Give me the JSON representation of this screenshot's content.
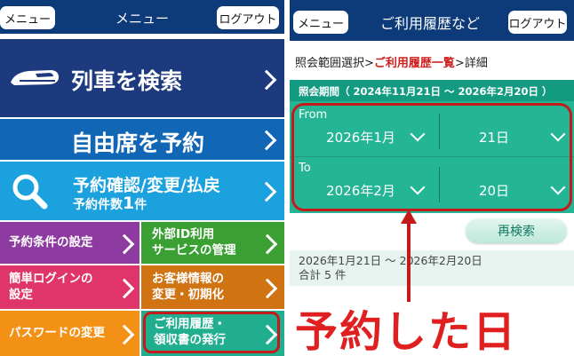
{
  "left": {
    "header": {
      "menu_button": "メニュー",
      "title": "メニュー",
      "logout_button": "ログアウト"
    },
    "tiles": {
      "search_train": "列車を検索",
      "reserve_free_seat": "自由席を予約",
      "confirm_line1": "予約確認/変更/払戻",
      "confirm_count_prefix": "予約件数",
      "confirm_count": "1",
      "confirm_count_suffix": "件",
      "reservation_conditions": "予約条件の設定",
      "external_id_line1": "外部ID利用",
      "external_id_line2": "サービスの管理",
      "easy_login_line1": "簡単ログインの",
      "easy_login_line2": "設定",
      "customer_info_line1": "お客様情報の",
      "customer_info_line2": "変更・初期化",
      "password_change": "パスワードの変更",
      "history_line1": "ご利用履歴・",
      "history_line2": "領収書の発行"
    }
  },
  "right": {
    "header": {
      "menu_button": "メニュー",
      "title": "ご利用履歴など",
      "logout_button": "ログアウト"
    },
    "breadcrumb": {
      "step1": "照会範囲選択>",
      "step2": "ご利用履歴一覧",
      "step3": ">詳細"
    },
    "period": "照会期間（ 2024年11月21日 ～ 2026年2月20日 ）",
    "from": {
      "label": "From",
      "month": "2026年1月",
      "day": "21日"
    },
    "to": {
      "label": "To",
      "month": "2026年2月",
      "day": "20日"
    },
    "research_button": "再検索",
    "result_range": "2026年1月21日 ～ 2026年2月20日",
    "result_total": "合計 5 件"
  },
  "annotation": {
    "text": "予約した日"
  },
  "colors": {
    "header_navy": "#0d3a78",
    "tile_search": "#1d3a7e",
    "tile_free_seat": "#1167b5",
    "tile_confirm": "#1aa1de",
    "tile_conditions": "#8e3ba1",
    "tile_external_id": "#3aa033",
    "tile_easy_login": "#e0356a",
    "tile_customer_info": "#cf7313",
    "tile_password": "#f39117",
    "tile_history": "#21ae8e",
    "highlight_red": "#c41a1a",
    "selector_teal": "#24b595"
  },
  "icons": [
    "shinkansen-icon",
    "magnifier-icon",
    "chevron-right-icon",
    "chevron-down-icon",
    "up-arrow-icon"
  ]
}
